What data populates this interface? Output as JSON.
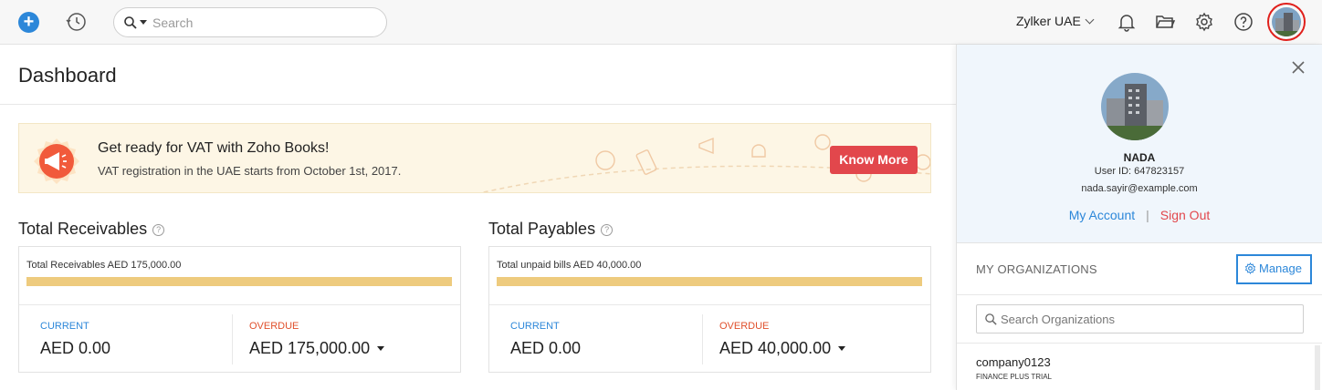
{
  "topbar": {
    "search_placeholder": "Search",
    "org_name": "Zylker UAE",
    "icons": [
      "plus-icon",
      "history-icon",
      "search-icon",
      "bell-icon",
      "folder-icon",
      "gear-icon",
      "help-icon"
    ]
  },
  "page": {
    "title": "Dashboard"
  },
  "banner": {
    "title": "Get ready for VAT with Zoho Books!",
    "subtitle": "VAT registration in the UAE starts from October 1st, 2017.",
    "button": "Know More"
  },
  "receivables": {
    "heading": "Total Receivables",
    "total_text": "Total Receivables AED 175,000.00",
    "current_label": "CURRENT",
    "current_value": "AED 0.00",
    "overdue_label": "OVERDUE",
    "overdue_value": "AED 175,000.00"
  },
  "payables": {
    "heading": "Total Payables",
    "total_text": "Total unpaid bills AED 40,000.00",
    "current_label": "CURRENT",
    "current_value": "AED 0.00",
    "overdue_label": "OVERDUE",
    "overdue_value": "AED 40,000.00"
  },
  "profile": {
    "name": "NADA",
    "user_id": "User ID: 647823157",
    "email": "nada.sayir@example.com",
    "my_account": "My Account",
    "separator": "|",
    "sign_out": "Sign Out",
    "orgs_heading": "MY ORGANIZATIONS",
    "manage": "Manage",
    "search_placeholder": "Search Organizations",
    "orgs": [
      {
        "name": "company0123",
        "plan": "FINANCE PLUS TRIAL"
      }
    ]
  },
  "colors": {
    "accent": "#2c87d9",
    "danger": "#e2474c",
    "bar": "#eecb7e",
    "banner_bg": "#fdf6e5",
    "panel_bg": "#f0f6fc"
  }
}
